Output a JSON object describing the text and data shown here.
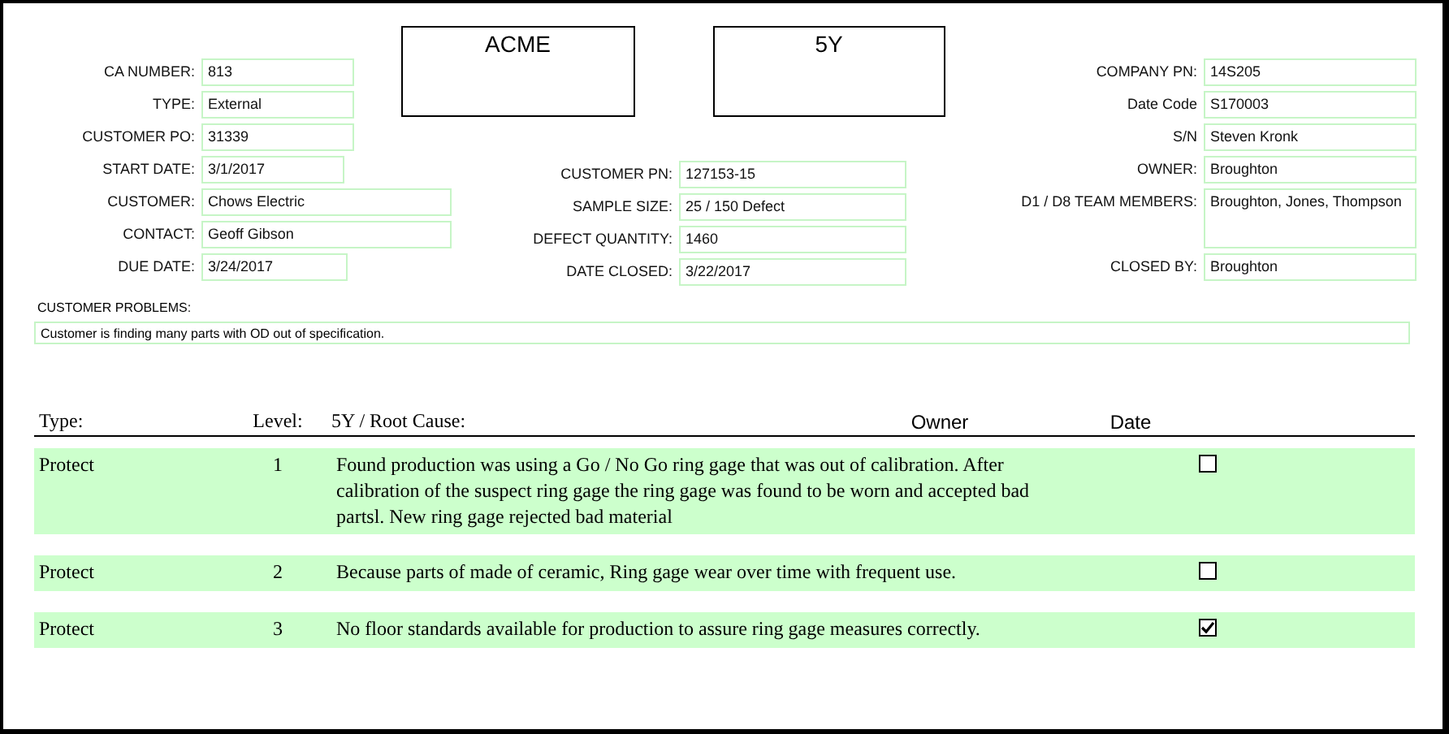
{
  "header_boxes": [
    "ACME",
    "5Y"
  ],
  "left_fields": [
    {
      "label": "CA NUMBER:",
      "value": "813"
    },
    {
      "label": "TYPE:",
      "value": "External"
    },
    {
      "label": "CUSTOMER PO:",
      "value": "31339"
    },
    {
      "label": "START DATE:",
      "value": "3/1/2017"
    },
    {
      "label": "CUSTOMER:",
      "value": "Chows Electric"
    },
    {
      "label": "CONTACT:",
      "value": "Geoff Gibson"
    },
    {
      "label": "DUE DATE:",
      "value": "3/24/2017"
    }
  ],
  "middle_fields": [
    {
      "label": "CUSTOMER PN:",
      "value": "127153-15"
    },
    {
      "label": "SAMPLE SIZE:",
      "value": "25 / 150 Defect"
    },
    {
      "label": "DEFECT QUANTITY:",
      "value": "1460"
    },
    {
      "label": "DATE CLOSED:",
      "value": "3/22/2017"
    }
  ],
  "right_fields": [
    {
      "label": "COMPANY PN:",
      "value": "14S205"
    },
    {
      "label": "Date Code",
      "value": "S170003"
    },
    {
      "label": "S/N",
      "value": "Steven Kronk"
    },
    {
      "label": "OWNER:",
      "value": "Broughton"
    },
    {
      "label": "D1 / D8 TEAM MEMBERS:",
      "value": "Broughton, Jones, Thompson"
    },
    {
      "label": "CLOSED BY:",
      "value": "Broughton"
    }
  ],
  "customer_problems": {
    "label": "CUSTOMER PROBLEMS:",
    "value": "Customer is finding many parts with OD out of specification."
  },
  "table": {
    "columns": [
      "Type:",
      "Level:",
      "5Y / Root Cause:",
      "Owner",
      "Date"
    ],
    "rows": [
      {
        "type": "Protect",
        "level": "1",
        "cause": "Found production was using a  Go / No Go ring gage that was out of calibration. After calibration of the suspect ring gage the ring gage was found to be worn and accepted bad partsl. New ring gage rejected bad material",
        "checked": false
      },
      {
        "type": "Protect",
        "level": "2",
        "cause": "Because parts of made of ceramic, Ring gage wear over time with frequent use.",
        "checked": false
      },
      {
        "type": "Protect",
        "level": "3",
        "cause": "No floor standards available for production to assure ring gage measures correctly.",
        "checked": true
      }
    ]
  }
}
